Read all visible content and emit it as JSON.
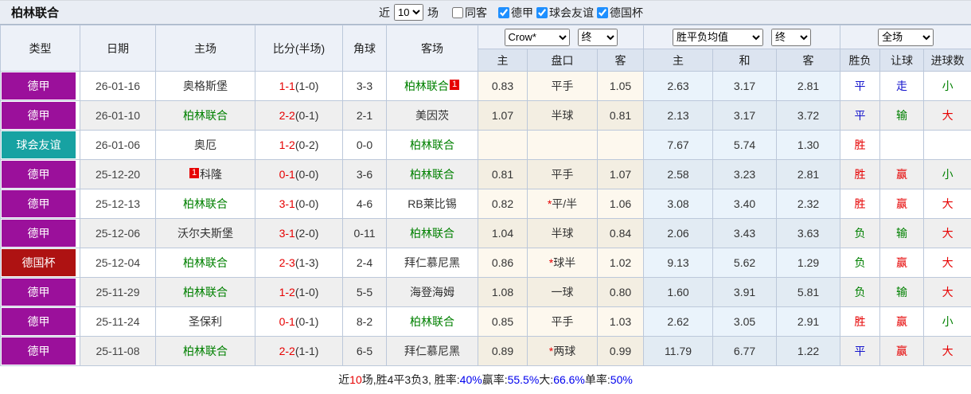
{
  "topbar": {
    "title": "柏林联合",
    "near_label": "近",
    "games_label": "场",
    "count_select": {
      "value": "10"
    },
    "filters": [
      {
        "label": "同客",
        "checked": false
      },
      {
        "label": "德甲",
        "checked": true
      },
      {
        "label": "球会友谊",
        "checked": true
      },
      {
        "label": "德国杯",
        "checked": true
      }
    ]
  },
  "table": {
    "columns": [
      "类型",
      "日期",
      "主场",
      "比分(半场)",
      "角球",
      "客场"
    ],
    "sub_columns": [
      "主",
      "盘口",
      "客",
      "主",
      "和",
      "客",
      "胜负",
      "让球",
      "进球数"
    ],
    "selects": {
      "odds_source": {
        "value": "Crow*"
      },
      "ah_time": {
        "value": "终"
      },
      "avg_type": {
        "value": "胜平负均值"
      },
      "avg_time": {
        "value": "终"
      },
      "scope": {
        "value": "全场"
      }
    },
    "rows": [
      {
        "type": "德甲",
        "type_key": "league",
        "date": "26-01-16",
        "home": {
          "name": "奥格斯堡",
          "green": false,
          "redcard": null
        },
        "score": "1-1",
        "half": "(1-0)",
        "corner": "3-3",
        "away": {
          "name": "柏林联合",
          "green": true,
          "redcard": "1",
          "redcard_pos": "after"
        },
        "ah": [
          "0.83",
          "平手",
          "1.05"
        ],
        "ah_star": false,
        "avg": [
          "2.63",
          "3.17",
          "2.81"
        ],
        "result": {
          "text": "平",
          "color": "blue"
        },
        "handicap": {
          "text": "走",
          "color": "blue"
        },
        "goals": {
          "text": "小",
          "color": "green"
        }
      },
      {
        "type": "德甲",
        "type_key": "league",
        "date": "26-01-10",
        "home": {
          "name": "柏林联合",
          "green": true,
          "redcard": null
        },
        "score": "2-2",
        "half": "(0-1)",
        "corner": "2-1",
        "away": {
          "name": "美因茨",
          "green": false,
          "redcard": null
        },
        "ah": [
          "1.07",
          "半球",
          "0.81"
        ],
        "ah_star": false,
        "avg": [
          "2.13",
          "3.17",
          "3.72"
        ],
        "result": {
          "text": "平",
          "color": "blue"
        },
        "handicap": {
          "text": "输",
          "color": "green"
        },
        "goals": {
          "text": "大",
          "color": "red"
        }
      },
      {
        "type": "球会友谊",
        "type_key": "friendly",
        "date": "26-01-06",
        "home": {
          "name": "奥厄",
          "green": false,
          "redcard": null
        },
        "score": "1-2",
        "half": "(0-2)",
        "corner": "0-0",
        "away": {
          "name": "柏林联合",
          "green": true,
          "redcard": null
        },
        "ah": [
          "",
          "",
          ""
        ],
        "ah_star": false,
        "avg": [
          "7.67",
          "5.74",
          "1.30"
        ],
        "result": {
          "text": "胜",
          "color": "red"
        },
        "handicap": {
          "text": "",
          "color": "red"
        },
        "goals": {
          "text": "",
          "color": "red"
        }
      },
      {
        "type": "德甲",
        "type_key": "league",
        "date": "25-12-20",
        "home": {
          "name": "科隆",
          "green": false,
          "redcard": "1",
          "redcard_pos": "before"
        },
        "score": "0-1",
        "half": "(0-0)",
        "corner": "3-6",
        "away": {
          "name": "柏林联合",
          "green": true,
          "redcard": null
        },
        "ah": [
          "0.81",
          "平手",
          "1.07"
        ],
        "ah_star": false,
        "avg": [
          "2.58",
          "3.23",
          "2.81"
        ],
        "result": {
          "text": "胜",
          "color": "red"
        },
        "handicap": {
          "text": "赢",
          "color": "red"
        },
        "goals": {
          "text": "小",
          "color": "green"
        }
      },
      {
        "type": "德甲",
        "type_key": "league",
        "date": "25-12-13",
        "home": {
          "name": "柏林联合",
          "green": true,
          "redcard": null
        },
        "score": "3-1",
        "half": "(0-0)",
        "corner": "4-6",
        "away": {
          "name": "RB莱比锡",
          "green": false,
          "redcard": null
        },
        "ah": [
          "0.82",
          "平/半",
          "1.06"
        ],
        "ah_star": true,
        "avg": [
          "3.08",
          "3.40",
          "2.32"
        ],
        "result": {
          "text": "胜",
          "color": "red"
        },
        "handicap": {
          "text": "赢",
          "color": "red"
        },
        "goals": {
          "text": "大",
          "color": "red"
        }
      },
      {
        "type": "德甲",
        "type_key": "league",
        "date": "25-12-06",
        "home": {
          "name": "沃尔夫斯堡",
          "green": false,
          "redcard": null
        },
        "score": "3-1",
        "half": "(2-0)",
        "corner": "0-11",
        "away": {
          "name": "柏林联合",
          "green": true,
          "redcard": null
        },
        "ah": [
          "1.04",
          "半球",
          "0.84"
        ],
        "ah_star": false,
        "avg": [
          "2.06",
          "3.43",
          "3.63"
        ],
        "result": {
          "text": "负",
          "color": "green"
        },
        "handicap": {
          "text": "输",
          "color": "green"
        },
        "goals": {
          "text": "大",
          "color": "red"
        }
      },
      {
        "type": "德国杯",
        "type_key": "cup",
        "date": "25-12-04",
        "home": {
          "name": "柏林联合",
          "green": true,
          "redcard": null
        },
        "score": "2-3",
        "half": "(1-3)",
        "corner": "2-4",
        "away": {
          "name": "拜仁慕尼黑",
          "green": false,
          "redcard": null
        },
        "ah": [
          "0.86",
          "球半",
          "1.02"
        ],
        "ah_star": true,
        "avg": [
          "9.13",
          "5.62",
          "1.29"
        ],
        "result": {
          "text": "负",
          "color": "green"
        },
        "handicap": {
          "text": "赢",
          "color": "red"
        },
        "goals": {
          "text": "大",
          "color": "red"
        }
      },
      {
        "type": "德甲",
        "type_key": "league",
        "date": "25-11-29",
        "home": {
          "name": "柏林联合",
          "green": true,
          "redcard": null
        },
        "score": "1-2",
        "half": "(1-0)",
        "corner": "5-5",
        "away": {
          "name": "海登海姆",
          "green": false,
          "redcard": null
        },
        "ah": [
          "1.08",
          "一球",
          "0.80"
        ],
        "ah_star": false,
        "avg": [
          "1.60",
          "3.91",
          "5.81"
        ],
        "result": {
          "text": "负",
          "color": "green"
        },
        "handicap": {
          "text": "输",
          "color": "green"
        },
        "goals": {
          "text": "大",
          "color": "red"
        }
      },
      {
        "type": "德甲",
        "type_key": "league",
        "date": "25-11-24",
        "home": {
          "name": "圣保利",
          "green": false,
          "redcard": null
        },
        "score": "0-1",
        "half": "(0-1)",
        "corner": "8-2",
        "away": {
          "name": "柏林联合",
          "green": true,
          "redcard": null
        },
        "ah": [
          "0.85",
          "平手",
          "1.03"
        ],
        "ah_star": false,
        "avg": [
          "2.62",
          "3.05",
          "2.91"
        ],
        "result": {
          "text": "胜",
          "color": "red"
        },
        "handicap": {
          "text": "赢",
          "color": "red"
        },
        "goals": {
          "text": "小",
          "color": "green"
        }
      },
      {
        "type": "德甲",
        "type_key": "league",
        "date": "25-11-08",
        "home": {
          "name": "柏林联合",
          "green": true,
          "redcard": null
        },
        "score": "2-2",
        "half": "(1-1)",
        "corner": "6-5",
        "away": {
          "name": "拜仁慕尼黑",
          "green": false,
          "redcard": null
        },
        "ah": [
          "0.89",
          "两球",
          "0.99"
        ],
        "ah_star": true,
        "avg": [
          "11.79",
          "6.77",
          "1.22"
        ],
        "result": {
          "text": "平",
          "color": "blue"
        },
        "handicap": {
          "text": "赢",
          "color": "red"
        },
        "goals": {
          "text": "大",
          "color": "red"
        }
      }
    ]
  },
  "footer": {
    "segments": [
      {
        "text": "近",
        "color": "black"
      },
      {
        "text": "10",
        "color": "red"
      },
      {
        "text": "场,胜4平3负3, 胜率:",
        "color": "black"
      },
      {
        "text": "40%",
        "color": "blue"
      },
      {
        "text": " 赢率:",
        "color": "black"
      },
      {
        "text": "55.5%",
        "color": "blue"
      },
      {
        "text": " 大:",
        "color": "black"
      },
      {
        "text": "66.6%",
        "color": "blue"
      },
      {
        "text": " 单率:",
        "color": "black"
      },
      {
        "text": "50%",
        "color": "blue"
      }
    ]
  },
  "colors": {
    "league_badge": "#9B109B",
    "friendly_badge": "#17A2A2",
    "cup_badge": "#AE1212",
    "team_highlight_green": "#008000",
    "score_red": "#E60000",
    "win_red": "#E60000",
    "draw_blue": "#1414CC",
    "lose_green": "#008000",
    "stat_blue": "#0000EE",
    "header_bg": "#DCE4F0",
    "ah_col_bg": "#FDF8EE",
    "avg_col_bg": "#EAF3FB"
  }
}
